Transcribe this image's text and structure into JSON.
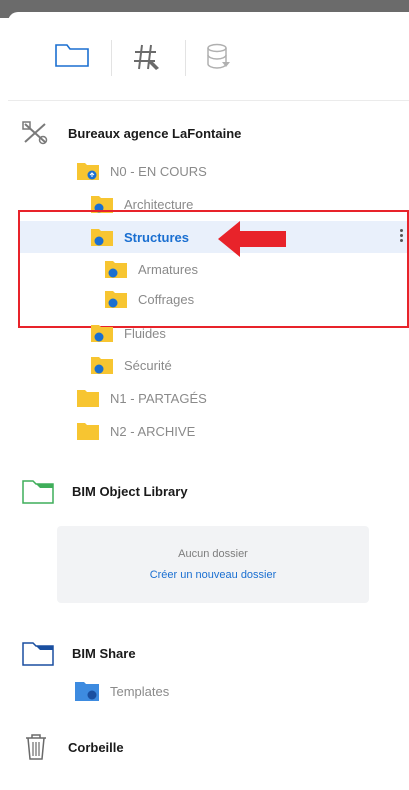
{
  "colors": {
    "accent_blue": "#1a6fd1",
    "folder_yellow": "#f7c531",
    "folder_blue": "#3d8be0",
    "highlight_red": "#e8232a",
    "bim_object_green": "#3fae5a"
  },
  "tabs": [
    {
      "name": "folders-tab",
      "icon": "folder-outline-icon"
    },
    {
      "name": "tags-tab",
      "icon": "hashtag-icon"
    },
    {
      "name": "database-tab",
      "icon": "database-icon"
    }
  ],
  "project": {
    "icon": "tools-icon",
    "title": "Bureaux agence LaFontaine"
  },
  "tree": {
    "n0": "N0 - EN COURS",
    "architecture": "Architecture",
    "structures": "Structures",
    "armatures": "Armatures",
    "coffrages": "Coffrages",
    "fluides": "Fluides",
    "securite": "Sécurité",
    "n1": "N1 - PARTAGÉS",
    "n2": "N2 - ARCHIVE"
  },
  "bim_object_library": {
    "title": "BIM Object Library",
    "empty_text": "Aucun dossier",
    "create_link": "Créer un nouveau dossier"
  },
  "bim_share": {
    "title": "BIM Share",
    "templates": "Templates"
  },
  "trash": {
    "title": "Corbeille"
  }
}
